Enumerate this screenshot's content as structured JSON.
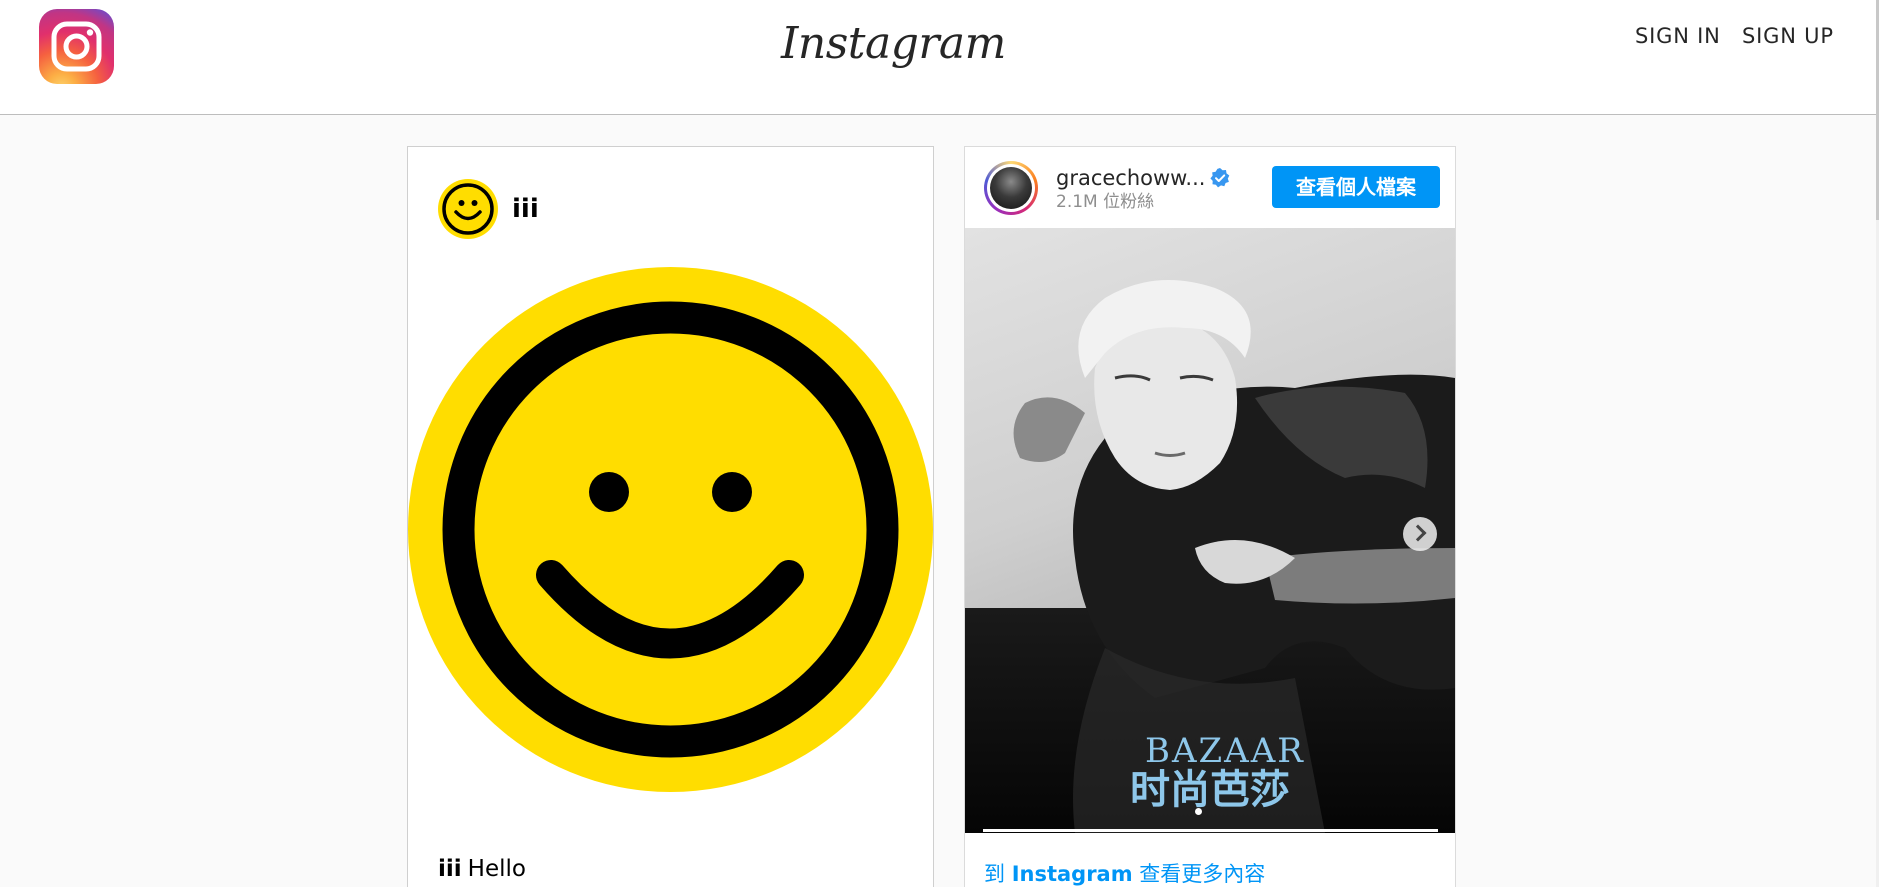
{
  "header": {
    "brand": "Instagram",
    "sign_in": "SIGN IN",
    "sign_up": "SIGN UP"
  },
  "left_card": {
    "username": "iii",
    "caption_user": "iii",
    "caption_text": "Hello"
  },
  "right_card": {
    "username": "gracechoww...",
    "followers": "2.1M 位粉絲",
    "profile_button": "查看個人檔案",
    "magazine_title": "BAZAAR",
    "magazine_subtitle": "时尚芭莎",
    "more_prefix": "到 ",
    "more_brand": "Instagram",
    "more_suffix": " 查看更多內容"
  },
  "colors": {
    "accent": "#0095f6",
    "smiley_yellow": "#ffdd00"
  }
}
